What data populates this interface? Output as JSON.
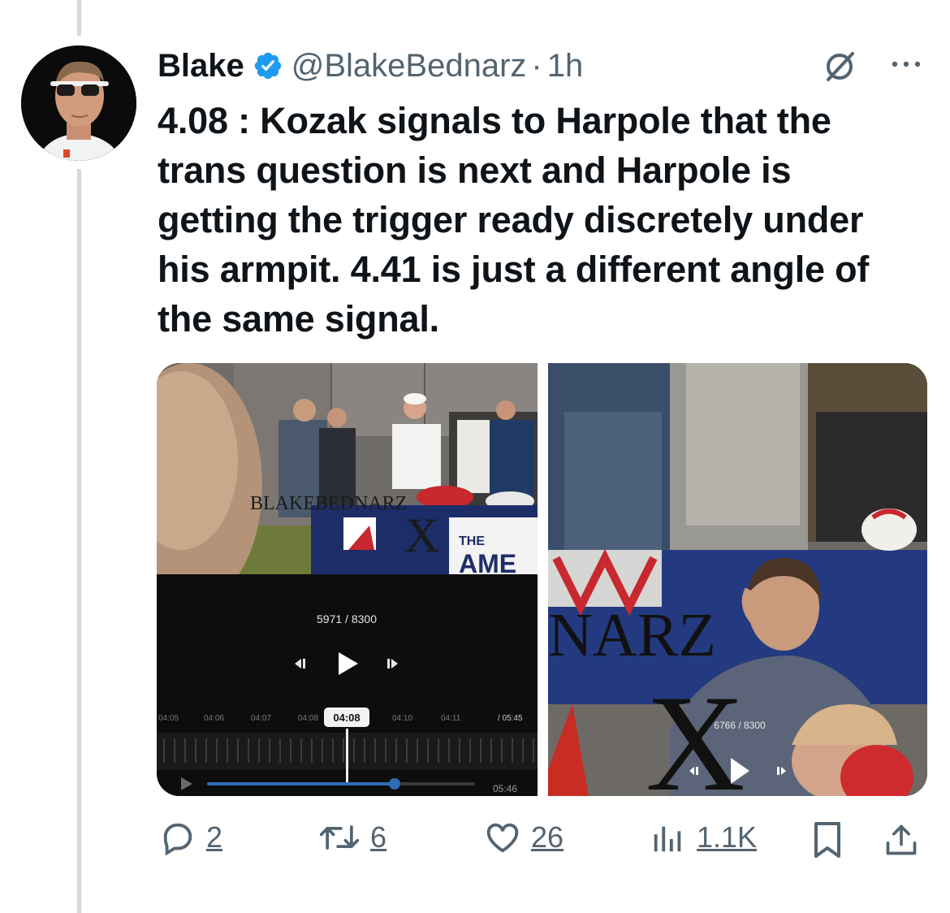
{
  "author": {
    "name": "Blake",
    "handle": "@BlakeBednarz",
    "separator": "·",
    "time": "1h"
  },
  "tweet": {
    "text": "4.08 : Kozak signals to Harpole that the trans question is next and Harpole is getting the trigger ready discretely under his armpit. 4.41 is just a different angle of the same signal."
  },
  "media": {
    "left": {
      "watermark": "BLAKEBEDNARZ",
      "watermark_x": "X",
      "sign_text_1": "THE",
      "sign_text_2": "AME",
      "frame_counter": "5971 / 8300",
      "timeline_ticks": [
        "04:05",
        "04:06",
        "04:07",
        "04:08"
      ],
      "timeline_current": "04:08",
      "timeline_ticks_after": [
        "04:10",
        "04:11"
      ],
      "total_time": "/ 05:45",
      "duration": "05:46",
      "progress": 0.7
    },
    "right": {
      "watermark": "NARZ",
      "watermark_x": "X",
      "frame_counter": "6766 / 8300"
    }
  },
  "actions": {
    "replies": "2",
    "reposts": "6",
    "likes": "26",
    "views": "1.1K"
  },
  "colors": {
    "verified": "#1d9bf0",
    "secondary_text": "#536471",
    "thread_line": "#cfd9de"
  }
}
